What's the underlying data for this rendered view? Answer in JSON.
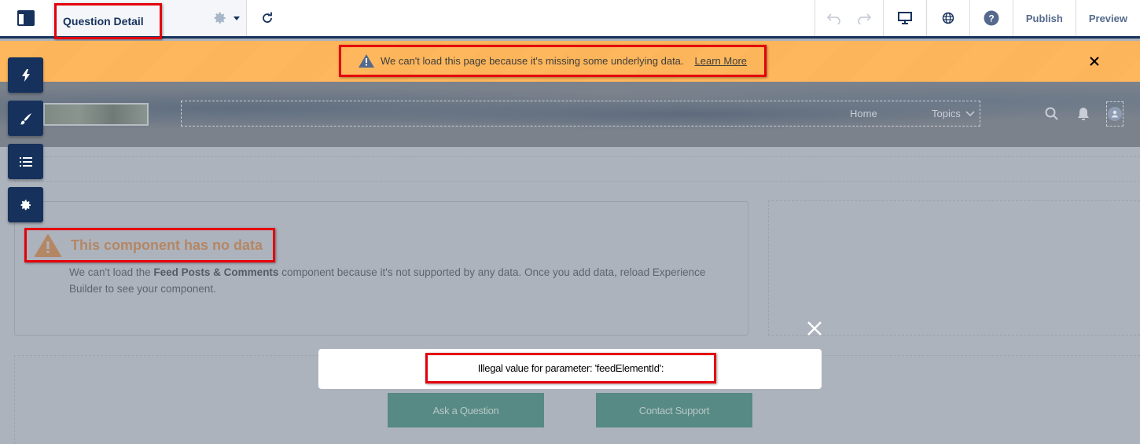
{
  "topbar": {
    "page_title": "Question Detail",
    "publish_label": "Publish",
    "preview_label": "Preview"
  },
  "alert": {
    "message": "We can't load this page because it's missing some underlying data.",
    "link_label": "Learn More"
  },
  "site_nav": {
    "items": [
      {
        "label": "Home"
      },
      {
        "label": "Topics"
      }
    ]
  },
  "sidebar_tools": [
    {
      "icon": "lightning-icon",
      "name": "components"
    },
    {
      "icon": "paintbrush-icon",
      "name": "theme"
    },
    {
      "icon": "list-icon",
      "name": "page-structure"
    },
    {
      "icon": "gear-icon",
      "name": "settings"
    }
  ],
  "component_error": {
    "title": "This component has no data",
    "text_before": "We can't load the ",
    "component_name": "Feed Posts & Comments",
    "text_after": " component because it's not supported by any data. Once you add data, reload Experience Builder to see your component."
  },
  "toast": {
    "message": "Illegal value for parameter: 'feedElementId':"
  },
  "buttons": {
    "ask_question": "Ask a Question",
    "contact_support": "Contact Support"
  },
  "colors": {
    "brand_navy": "#16325c",
    "warning_orange": "#ffb75d",
    "cta_teal": "#578a84",
    "highlight_red": "#e4000b"
  }
}
